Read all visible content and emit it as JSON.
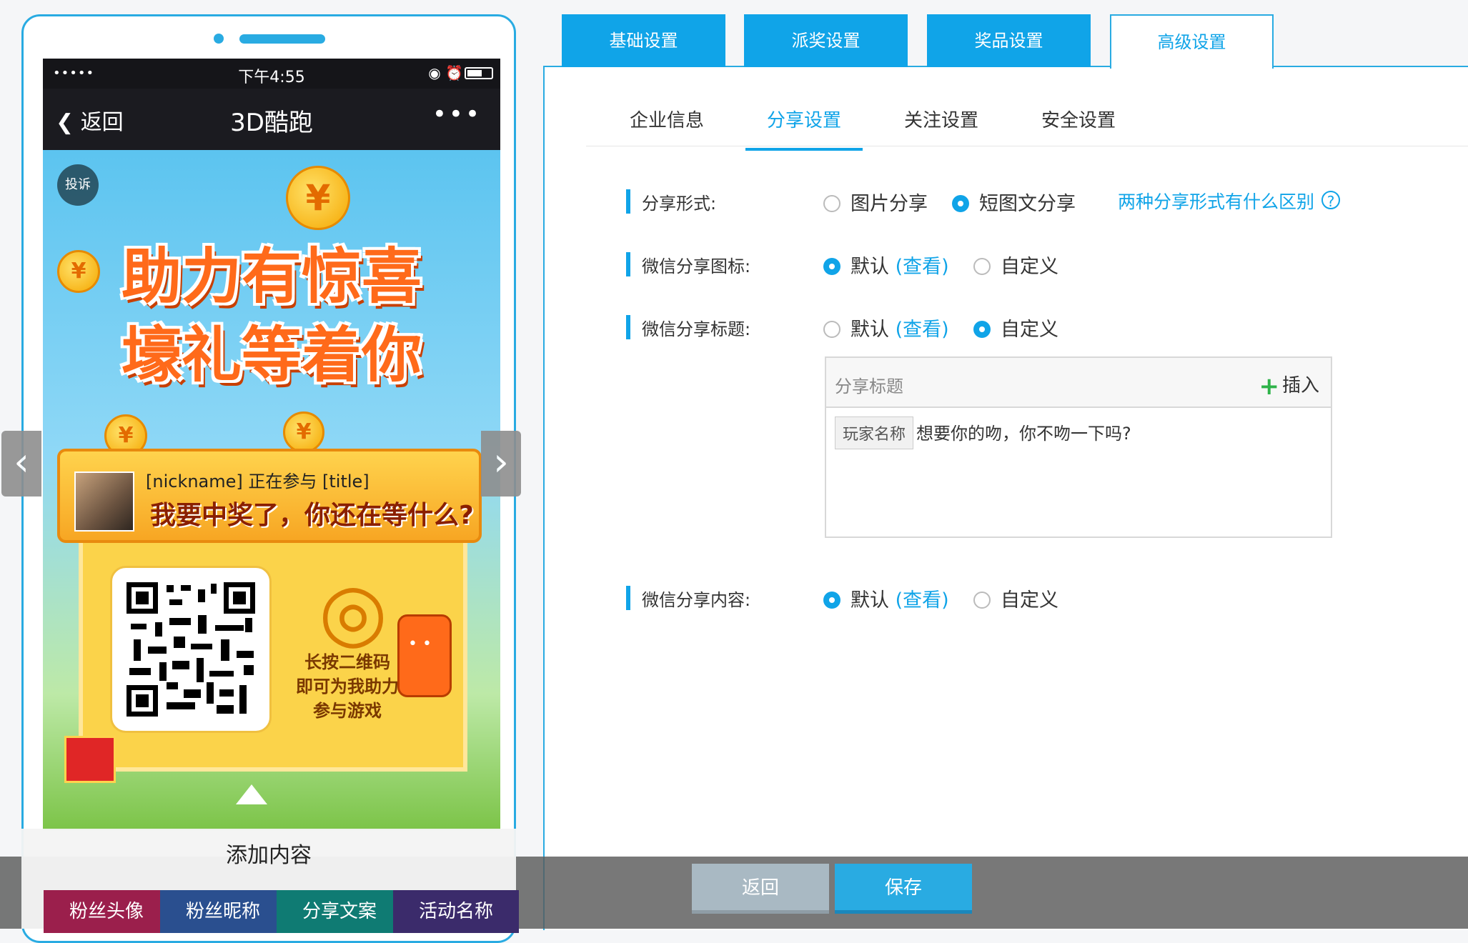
{
  "phone": {
    "status": {
      "signal": "•••••",
      "time": "下午4:55",
      "icons": "◉ ⏰"
    },
    "nav": {
      "back": "返回",
      "title": "3D酷跑",
      "more": "•••"
    },
    "poster": {
      "complain": "投诉",
      "headline_1": "助力有惊喜",
      "headline_2": "壕礼等着你",
      "coin_symbol": "¥",
      "invite_line1": "[nickname]  正在参与 [title]",
      "invite_line2": "我要中奖了，你还在等什么?",
      "scan_text": "长按二维码\n即可为我助力\n参与游戏"
    }
  },
  "tabs": [
    {
      "label": "基础设置",
      "active": false
    },
    {
      "label": "派奖设置",
      "active": false
    },
    {
      "label": "奖品设置",
      "active": false
    },
    {
      "label": "高级设置",
      "active": true
    }
  ],
  "subtabs": [
    {
      "label": "企业信息",
      "active": false
    },
    {
      "label": "分享设置",
      "active": true
    },
    {
      "label": "关注设置",
      "active": false
    },
    {
      "label": "安全设置",
      "active": false
    }
  ],
  "settings": {
    "share_form": {
      "label": "分享形式:",
      "options": [
        {
          "label": "图片分享",
          "selected": false
        },
        {
          "label": "短图文分享",
          "selected": true
        }
      ],
      "help_link": "两种分享形式有什么区别",
      "help_icon": "?"
    },
    "share_icon": {
      "label": "微信分享图标:",
      "default": "默认",
      "view": "(查看)",
      "custom": "自定义",
      "selected": "default"
    },
    "share_title": {
      "label": "微信分享标题:",
      "default": "默认",
      "view": "(查看)",
      "custom": "自定义",
      "selected": "custom",
      "editor": {
        "placeholder": "分享标题",
        "insert": "插入",
        "tag": "玩家名称",
        "text": "想要你的吻，你不吻一下吗?"
      }
    },
    "share_content": {
      "label": "微信分享内容:",
      "default": "默认",
      "view": "(查看)",
      "custom": "自定义",
      "selected": "default"
    }
  },
  "add_content": {
    "title": "添加内容",
    "chips": [
      {
        "label": "粉丝头像",
        "color": "#9b1f4c"
      },
      {
        "label": "粉丝昵称",
        "color": "#2a4f8f"
      },
      {
        "label": "分享文案",
        "color": "#0f7b73"
      },
      {
        "label": "活动名称",
        "color": "#3b2b6b"
      }
    ]
  },
  "footer": {
    "back": "返回",
    "save": "保存"
  },
  "colors": {
    "accent": "#10a4e8",
    "border": "#29abe2",
    "insert_plus": "#2fb34a"
  }
}
